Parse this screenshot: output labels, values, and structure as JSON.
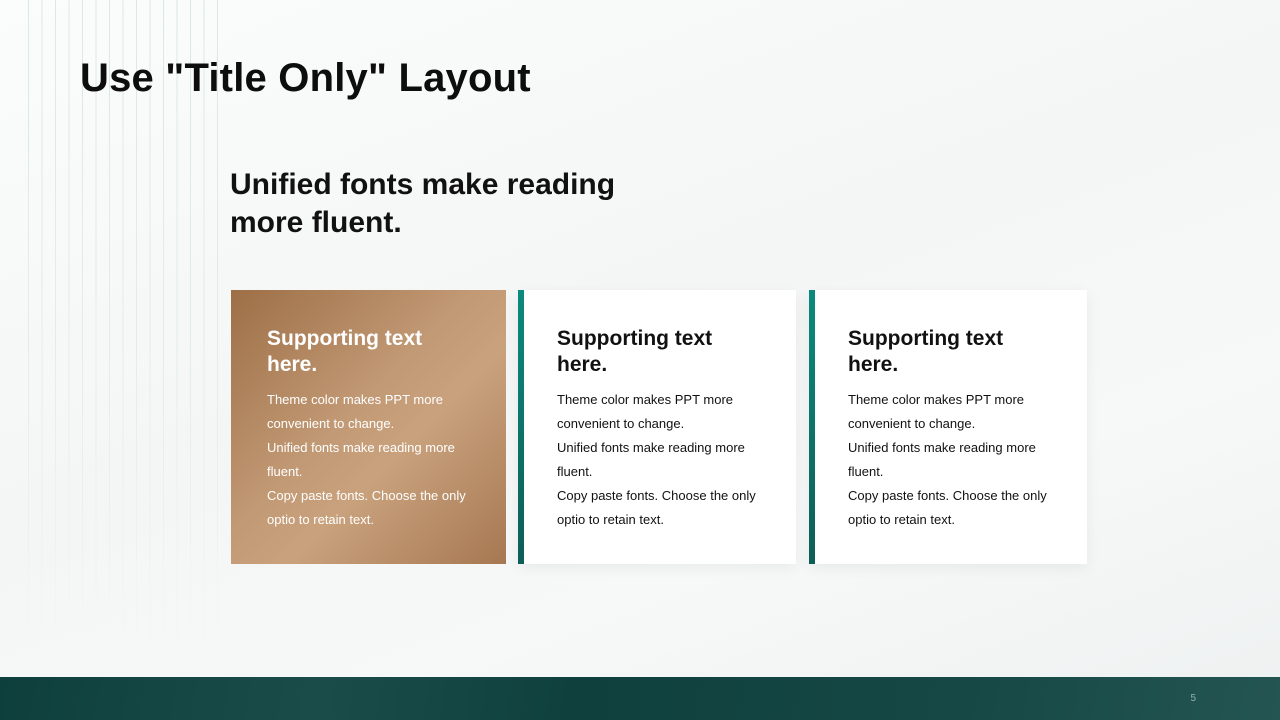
{
  "slide": {
    "title": "Use \"Title Only\" Layout",
    "subtitle": "Unified fonts make reading more fluent.",
    "page_number": "5"
  },
  "cards": [
    {
      "heading": "Supporting text here.",
      "lines": [
        "Theme color makes PPT more",
        "convenient  to change.",
        "Unified  fonts make reading more",
        "fluent.",
        "Copy paste fonts. Choose the only",
        "optio to retain text."
      ]
    },
    {
      "heading": "Supporting text here.",
      "lines": [
        "Theme color makes PPT more",
        "convenient  to change.",
        "Unified  fonts make reading more",
        "fluent.",
        "Copy paste fonts. Choose the only",
        "optio to retain text."
      ]
    },
    {
      "heading": "Supporting text here.",
      "lines": [
        "Theme color makes PPT more",
        "convenient  to change.",
        "Unified  fonts make reading more",
        "fluent.",
        "Copy paste fonts. Choose the only",
        "optio to retain text."
      ]
    }
  ],
  "colors": {
    "accent_teal": "#0a7e73",
    "accent_bronze": "#b48a62",
    "footer": "#0f403e"
  }
}
